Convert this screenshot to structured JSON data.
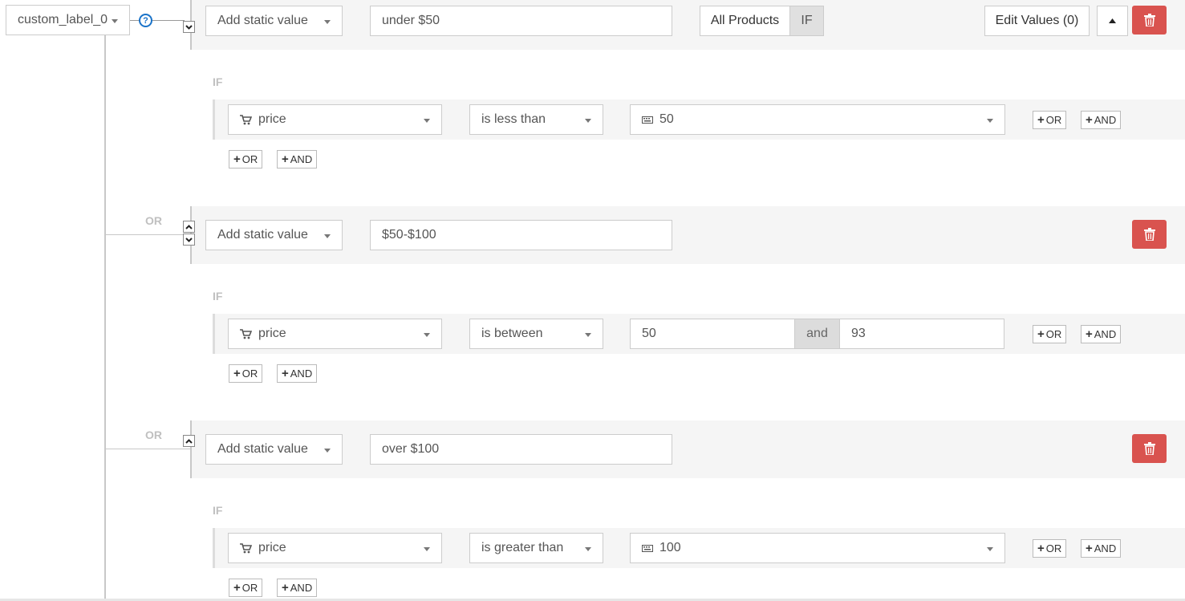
{
  "root": {
    "field_label": "custom_label_0",
    "help_glyph": "?"
  },
  "connector_label": "OR",
  "if_label": "IF",
  "top_bar": {
    "all_products_label": "All Products",
    "if_toggle_label": "IF",
    "edit_values_label": "Edit Values (0)"
  },
  "small_buttons": {
    "or_label": "OR",
    "and_label": "AND"
  },
  "rules": [
    {
      "value_type": "Add static value",
      "value": "under $50",
      "condition": {
        "attribute": "price",
        "operator": "is less than",
        "value": "50"
      }
    },
    {
      "value_type": "Add static value",
      "value": "$50-$100",
      "condition": {
        "attribute": "price",
        "operator": "is between",
        "value_from": "50",
        "between_word": "and",
        "value_to": "93"
      }
    },
    {
      "value_type": "Add static value",
      "value": "over $100",
      "condition": {
        "attribute": "price",
        "operator": "is greater than",
        "value": "100"
      }
    }
  ],
  "colors": {
    "danger": "#d9534f",
    "band": "#f5f5f5",
    "help": "#1a73c9"
  }
}
